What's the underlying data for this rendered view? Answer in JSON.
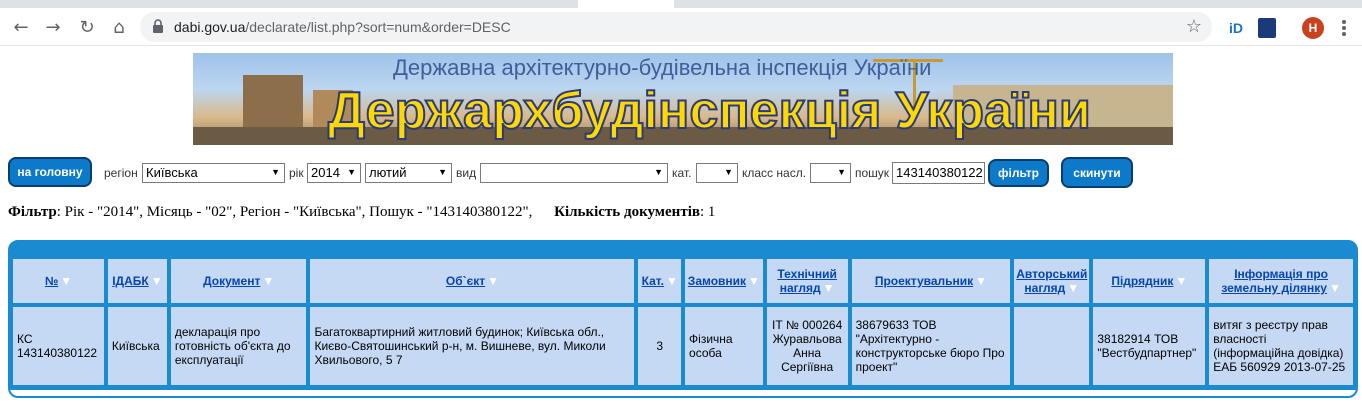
{
  "browser": {
    "url_host": "dabi.gov.ua",
    "url_path": "/declarate/list.php?sort=num&order=DESC",
    "avatar_letter": "H",
    "ext1": "iD"
  },
  "banner": {
    "subtitle": "Державна архітектурно-будівельна інспекція України",
    "title": "Держархбудінспекція України"
  },
  "filters": {
    "home_button": "на головну",
    "region_label": "регіон",
    "region_value": "Київська",
    "year_label": "рік",
    "year_value": "2014",
    "month_value": "лютий",
    "type_label": "вид",
    "type_value": "",
    "cat_label": "кат.",
    "cat_value": "",
    "class_label": "класс насл.",
    "class_value": "",
    "search_label": "пошук",
    "search_value": "143140380122",
    "filter_button": "фільтр",
    "reset_button": "скинути"
  },
  "filter_summary": {
    "label": "Фільтр",
    "text": ": Рік - \"2014\", Місяць - \"02\", Регіон - \"Київська\", Пошук - \"143140380122\",",
    "count_label": "Кількість документів",
    "count_value": ": 1"
  },
  "table": {
    "headers": [
      "№",
      "ІДАБК",
      "Документ",
      "Об`єкт",
      "Кат.",
      "Замовник",
      "Технічний нагляд",
      "Проектувальник",
      "Авторський нагляд",
      "Підрядник",
      "Інформація про земельну ділянку"
    ],
    "sort_glyph": "▼",
    "rows": [
      [
        "КС 143140380122",
        "Київська",
        "декларація про готовність об'єкта до експлуатації",
        "Багатоквартирний житловий будинок; Київська обл., Києво-Святошинський р-н, м. Вишневе, вул. Миколи Хвильового, 5 7",
        "3",
        "Фізична особа",
        "ІТ № 000264 Журавльова Анна Сергіївна",
        "38679633 ТОВ \"Архітектурно - конструкторське бюро Про проект\"",
        "",
        "38182914 ТОВ \"Вестбудпартнер\"",
        "витяг з реєстру прав власності (інформаційна довідка) ЕАБ 560929 2013-07-25"
      ]
    ]
  }
}
